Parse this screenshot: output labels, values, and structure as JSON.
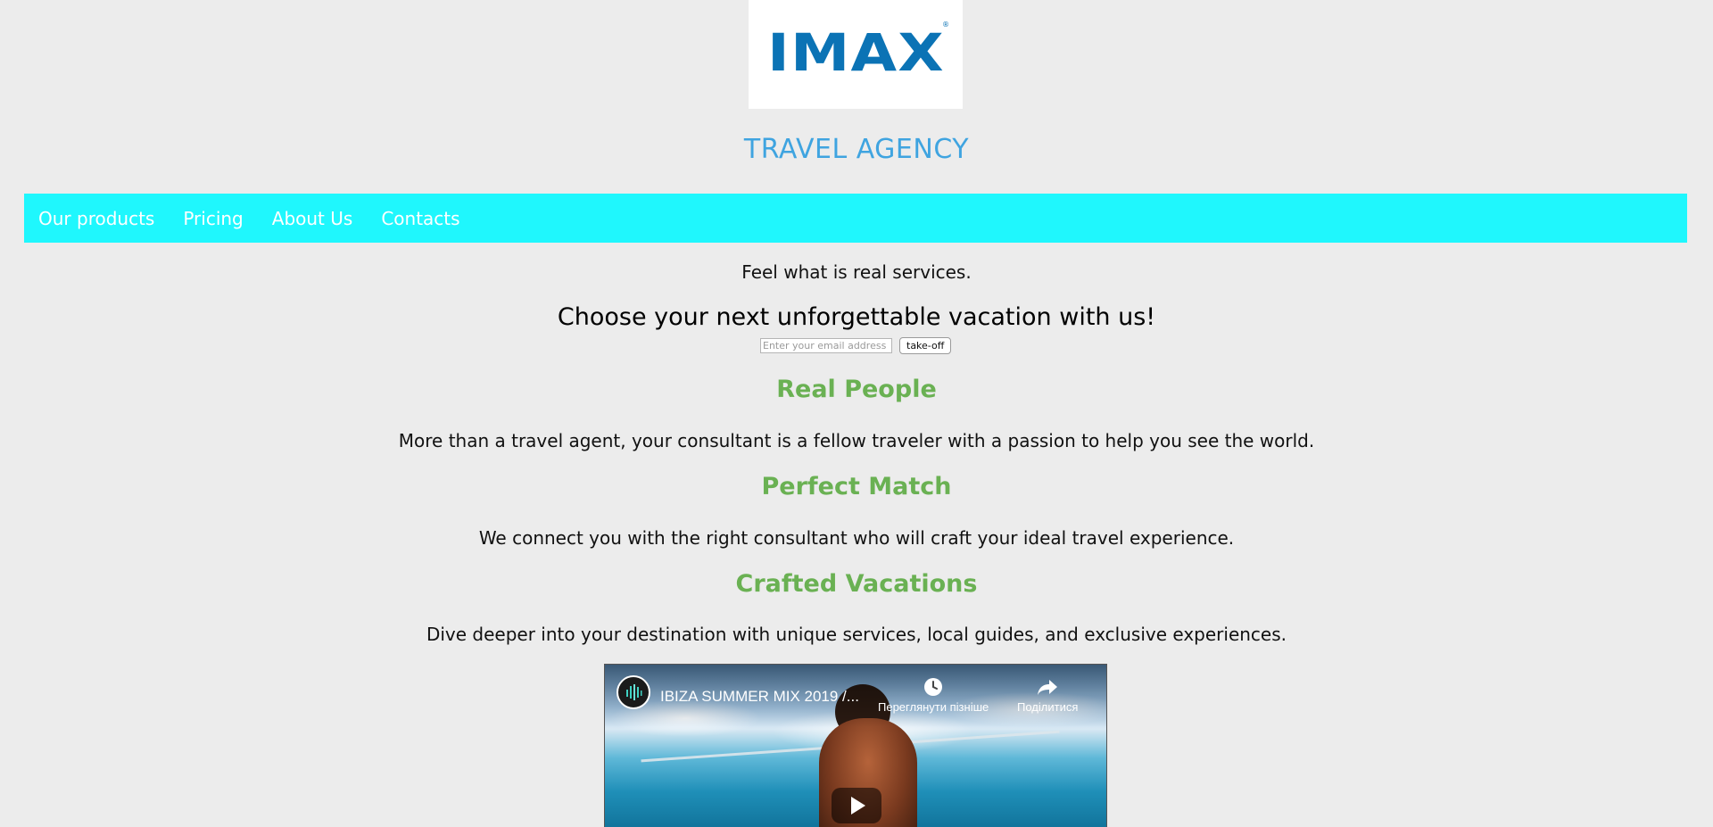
{
  "logo": {
    "text": "IMAX",
    "registered_mark": "®",
    "color": "#0b73b5"
  },
  "title": "TRAVEL AGENCY",
  "nav": {
    "background": "#1ff7fd",
    "items": [
      {
        "label": "Our products"
      },
      {
        "label": "Pricing"
      },
      {
        "label": "About Us"
      },
      {
        "label": "Contacts"
      }
    ]
  },
  "intro": {
    "tagline": "Feel what is real services.",
    "headline": "Choose your next unforgettable vacation with us!"
  },
  "signup": {
    "email_placeholder": "Enter your email address",
    "email_value": "",
    "button_label": "take-off"
  },
  "sections": [
    {
      "heading": "Real People",
      "text": "More than a travel agent, your consultant is a fellow traveler with a passion to help you see the world."
    },
    {
      "heading": "Perfect Match",
      "text": "We connect you with the right consultant who will craft your ideal travel experience."
    },
    {
      "heading": "Crafted Vacations",
      "text": "Dive deeper into your destination with unique services, local guides, and exclusive experiences."
    }
  ],
  "video": {
    "title": "IBIZA SUMMER MIX 2019 /...",
    "watch_later_label": "Переглянути пізніше",
    "share_label": "Поділитися",
    "watch_later_icon": "clock-icon",
    "share_icon": "share-icon",
    "play_icon": "play-icon"
  },
  "colors": {
    "page_background": "#ececec",
    "title": "#3fa4e0",
    "section_heading": "#6ab153"
  }
}
